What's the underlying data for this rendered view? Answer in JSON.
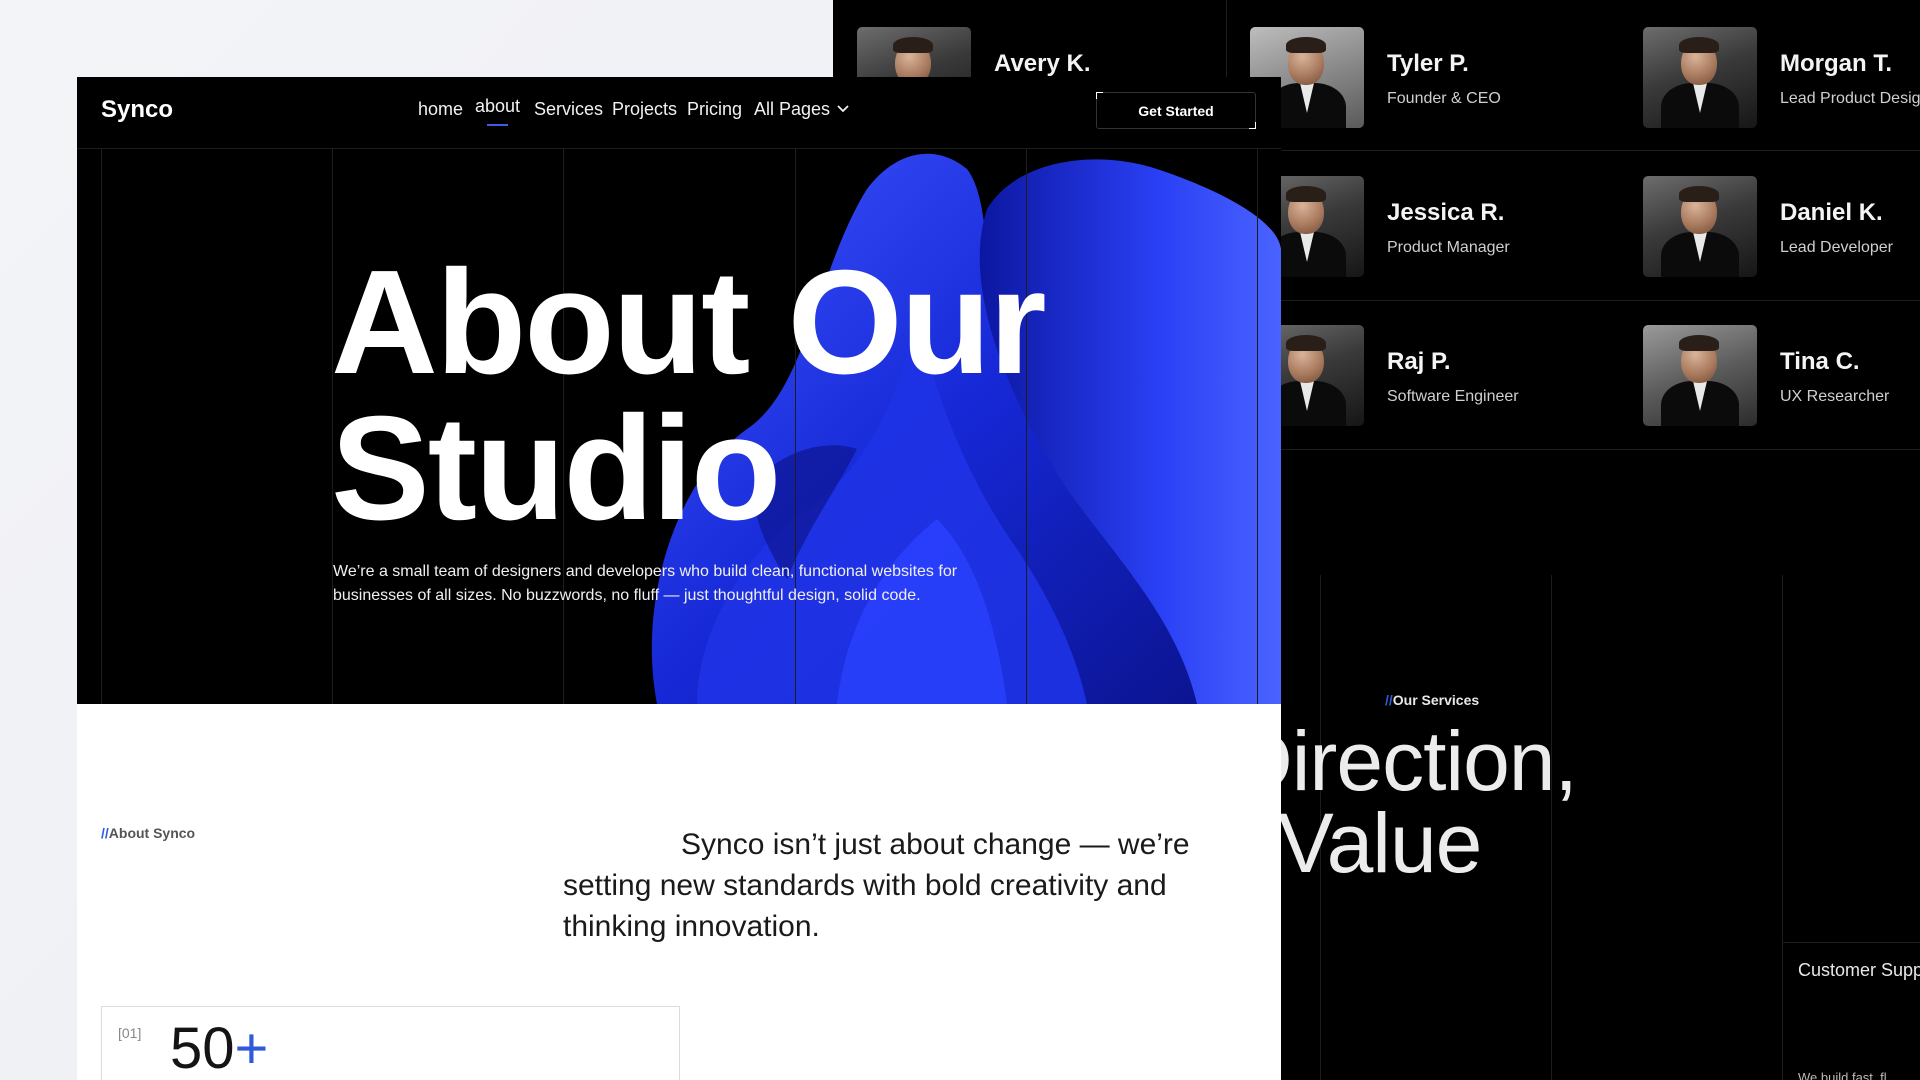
{
  "team": [
    {
      "name": "Avery K.",
      "role": ""
    },
    {
      "name": "Tyler P.",
      "role": "Founder & CEO"
    },
    {
      "name": "Morgan T.",
      "role": "Lead Product Desig"
    },
    {
      "name": "Jessica R.",
      "role": "Product Manager"
    },
    {
      "name": "Daniel K.",
      "role": "Lead Developer"
    },
    {
      "name": "Raj P.",
      "role": "Software Engineer"
    },
    {
      "name": "Tina C.",
      "role": "UX Researcher"
    }
  ],
  "services": {
    "tag_slash": "//",
    "tag": "Our Services",
    "heading_line1": "tive Direction,",
    "heading_line2": "sting Value",
    "card_title": "Customer Supp",
    "card_text": "We build fast, fl"
  },
  "header": {
    "logo": "Synco",
    "nav": [
      "home",
      "about",
      "Services",
      "Projects",
      "Pricing",
      "All Pages"
    ],
    "active_nav": "about",
    "cta": "Get Started"
  },
  "hero": {
    "title": "About Our\nStudio",
    "subtitle": "We’re a small team of designers and developers who build clean, functional websites for businesses of all sizes. No buzzwords, no fluff — just thoughtful design, solid code."
  },
  "about": {
    "tag_slash": "//",
    "tag": "About Synco",
    "text": "Synco isn’t just about change — we’re setting new standards with bold creativity and thinking innovation."
  },
  "stat": {
    "index": "[01]",
    "value": "50",
    "suffix": "+"
  },
  "colors": {
    "accent": "#2f5bd9",
    "blob": "#1a2fe0",
    "dark_bg": "#000000"
  }
}
